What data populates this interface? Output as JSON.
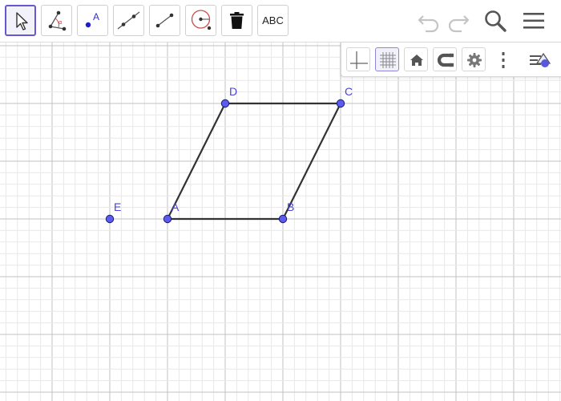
{
  "toolbar": {
    "tools": [
      {
        "name": "move-tool",
        "icon": "cursor-icon"
      },
      {
        "name": "angle-tool",
        "icon": "angle-icon"
      },
      {
        "name": "point-tool",
        "icon": "point-icon",
        "label": "A"
      },
      {
        "name": "line-tool",
        "icon": "line-icon"
      },
      {
        "name": "segment-tool",
        "icon": "segment-icon"
      },
      {
        "name": "circle-tool",
        "icon": "circle-icon"
      },
      {
        "name": "delete-tool",
        "icon": "trash-icon"
      },
      {
        "name": "text-tool",
        "icon": "text-icon",
        "label": "ABC"
      }
    ],
    "active_tool": "move-tool",
    "right_icons": [
      "undo-icon",
      "redo-icon",
      "search-icon",
      "menu-icon"
    ]
  },
  "graphics_style_bar": {
    "buttons": [
      "axes-icon",
      "grid-icon",
      "home-icon",
      "magnet-icon",
      "settings-icon",
      "more-icon",
      "style-bar-toggle-icon"
    ],
    "grid_on": true,
    "axes_on": false
  },
  "geometry": {
    "points": [
      {
        "id": "A",
        "label": "A",
        "x": 0,
        "y": 0
      },
      {
        "id": "B",
        "label": "B",
        "x": 2,
        "y": 0
      },
      {
        "id": "C",
        "label": "C",
        "x": 3,
        "y": 2
      },
      {
        "id": "D",
        "label": "D",
        "x": 1,
        "y": 2
      },
      {
        "id": "E",
        "label": "E",
        "x": -1,
        "y": 0
      }
    ],
    "segments": [
      [
        "A",
        "B"
      ],
      [
        "B",
        "C"
      ],
      [
        "C",
        "D"
      ],
      [
        "D",
        "A"
      ]
    ]
  },
  "colors": {
    "accent": "#6557d2",
    "point_fill": "#5b5bf0",
    "point_stroke": "#1a1a6e",
    "label": "#4b44d6",
    "segment": "#333333",
    "grid_major": "#c2c2c2",
    "grid_minor": "#e8e8e8"
  }
}
